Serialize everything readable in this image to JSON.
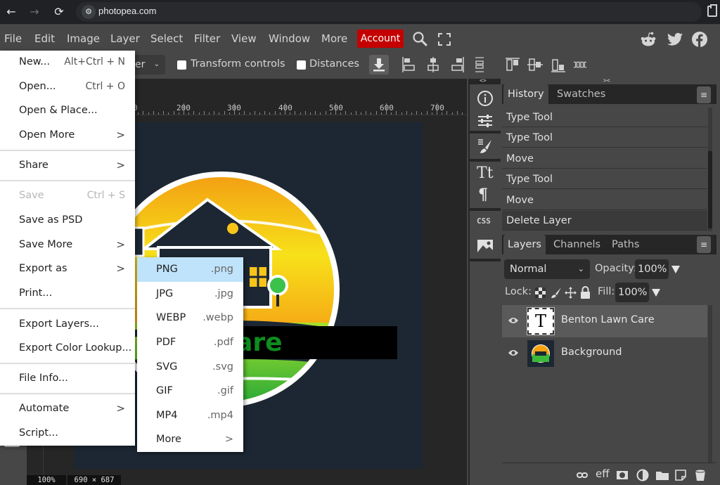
{
  "browser": {
    "url": "photopea.com",
    "back_icon": "arrow-left-icon",
    "forward_icon": "arrow-right-icon",
    "reload_icon": "reload-icon"
  },
  "menubar": {
    "items": [
      "File",
      "Edit",
      "Image",
      "Layer",
      "Select",
      "Filter",
      "View",
      "Window",
      "More"
    ],
    "account_label": "Account",
    "account_color": "#c40000"
  },
  "options_bar": {
    "mode_value": "er",
    "transform_controls_label": "Transform controls",
    "transform_controls_checked": false,
    "distances_label": "Distances",
    "distances_checked": false
  },
  "ruler": {
    "labels": [
      "0",
      "200",
      "300",
      "400",
      "500",
      "600",
      "700"
    ]
  },
  "status": {
    "zoom": "100%",
    "size": "690 × 687"
  },
  "canvas": {
    "visible_text": "awn Care"
  },
  "icon_column": {
    "collapse_left": "<>",
    "collapse_right": "><",
    "css_label": "CSS"
  },
  "history_panel": {
    "tabs": [
      "History",
      "Swatches"
    ],
    "active_tab": "History",
    "items": [
      "Type Tool",
      "Type Tool",
      "Move",
      "Type Tool",
      "Move",
      "Delete Layer"
    ],
    "current_index": 5
  },
  "layers_panel": {
    "tabs": [
      "Layers",
      "Channels",
      "Paths"
    ],
    "active_tab": "Layers",
    "blend_mode": "Normal",
    "opacity_label": "Opacity:",
    "opacity_value": "100%",
    "lock_label": "Lock:",
    "fill_label": "Fill:",
    "fill_value": "100%",
    "layers": [
      {
        "name": "Benton Lawn Care",
        "type": "text",
        "thumb_glyph": "T",
        "visible": true,
        "selected": true
      },
      {
        "name": "Background",
        "type": "image",
        "visible": true,
        "selected": false
      }
    ],
    "footer_eff_label": "eff"
  },
  "file_menu": {
    "items": [
      {
        "label": "New...",
        "shortcut": "Alt+Ctrl + N"
      },
      {
        "label": "Open...",
        "shortcut": "Ctrl + O"
      },
      {
        "label": "Open & Place..."
      },
      {
        "label": "Open More",
        "submenu": true
      },
      {
        "label": "Share",
        "submenu": true
      },
      {
        "label": "Save",
        "shortcut": "Ctrl + S",
        "disabled": true
      },
      {
        "label": "Save as PSD"
      },
      {
        "label": "Save More",
        "submenu": true
      },
      {
        "label": "Export as",
        "submenu": true
      },
      {
        "label": "Print..."
      },
      {
        "label": "Export Layers..."
      },
      {
        "label": "Export Color Lookup..."
      },
      {
        "label": "File Info..."
      },
      {
        "label": "Automate",
        "submenu": true
      },
      {
        "label": "Script..."
      }
    ],
    "arrow": ">"
  },
  "export_submenu": {
    "items": [
      {
        "label": "PNG",
        "ext": ".png",
        "highlighted": true
      },
      {
        "label": "JPG",
        "ext": ".jpg"
      },
      {
        "label": "WEBP",
        "ext": ".webp"
      },
      {
        "label": "PDF",
        "ext": ".pdf"
      },
      {
        "label": "SVG",
        "ext": ".svg"
      },
      {
        "label": "GIF",
        "ext": ".gif"
      },
      {
        "label": "MP4",
        "ext": ".mp4"
      },
      {
        "label": "More",
        "ext": ">"
      }
    ],
    "highlight_color": "#bfe3fb"
  }
}
